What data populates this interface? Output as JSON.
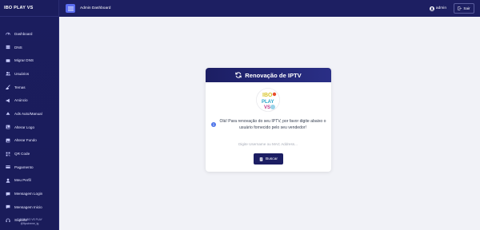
{
  "app": {
    "brand": "IBO PLAY VS"
  },
  "topbar": {
    "title": "Admin Dashboard",
    "user": "admin",
    "logout_label": "Sair"
  },
  "sidebar": {
    "items": [
      {
        "label": "Dashboard",
        "icon": "dashboard-icon"
      },
      {
        "label": "DNS",
        "icon": "dns-icon"
      },
      {
        "label": "Migrar DNS",
        "icon": "migrate-icon"
      },
      {
        "label": "Usuários",
        "icon": "users-icon"
      },
      {
        "label": "Temas",
        "icon": "themes-icon"
      },
      {
        "label": "Anúncio",
        "icon": "announcement-icon"
      },
      {
        "label": "Ads Auto/Manual",
        "icon": "ads-icon"
      },
      {
        "label": "Alterar Logo",
        "icon": "logo-icon"
      },
      {
        "label": "Alterar Fundo",
        "icon": "background-icon"
      },
      {
        "label": "QR Code",
        "icon": "qr-code-icon"
      },
      {
        "label": "Pagamento",
        "icon": "payment-icon"
      },
      {
        "label": "Meu Perfil",
        "icon": "profile-icon"
      },
      {
        "label": "Mensagem Login",
        "icon": "message-icon"
      },
      {
        "label": "Mensagem Inicio",
        "icon": "message-icon"
      },
      {
        "label": "Suporte",
        "icon": "support-icon"
      }
    ],
    "footer_line1": "© 2025 IBO VS PLAY",
    "footer_line2": "@flyscheme_tg"
  },
  "card": {
    "title": "Renovação de IPTV",
    "logo_text_top": "IBO",
    "logo_text_mid": "PLAY",
    "logo_text_bottom": "VS",
    "info_text": "Olá! Para renovação do seu IPTV, por favor digite abaixo o usuário fornecido pelo seu vendedor!",
    "search_placeholder": "Digite Username ou MAC Address...",
    "button_label": "Buscar"
  },
  "colors": {
    "sidebar": "#1b1d5e",
    "accent": "#5a6cf0",
    "header": "#1c1e63"
  }
}
